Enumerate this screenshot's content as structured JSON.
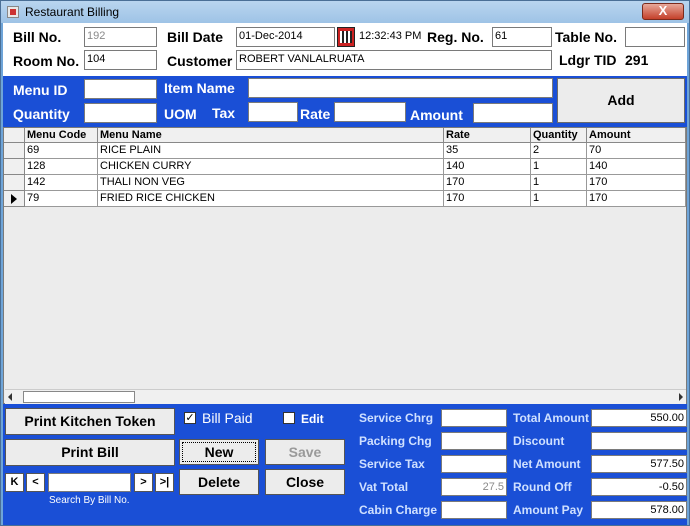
{
  "window": {
    "title": "Restaurant Billing",
    "close_label": "X"
  },
  "header": {
    "bill_no_label": "Bill No.",
    "bill_no": "192",
    "bill_date_label": "Bill Date",
    "bill_date": "01-Dec-2014",
    "time": "12:32:43 PM",
    "reg_no_label": "Reg. No.",
    "reg_no": "61",
    "table_no_label": "Table No.",
    "table_no": "",
    "room_no_label": "Room No.",
    "room_no": "104",
    "customer_label": "Customer",
    "customer": "ROBERT VANLALRUATA",
    "ledger_tid_label": "Ldgr TID",
    "ledger_tid": "291"
  },
  "entry": {
    "menu_id_label": "Menu ID",
    "menu_id": "",
    "item_name_label": "Item Name",
    "item_name": "",
    "quantity_label": "Quantity",
    "quantity": "",
    "uom_label": "UOM",
    "tax_label": "Tax",
    "tax": "",
    "rate_label": "Rate",
    "rate": "",
    "amount_label": "Amount",
    "amount": "",
    "add_label": "Add"
  },
  "grid": {
    "columns": [
      "Menu Code",
      "Menu Name",
      "Rate",
      "Quantity",
      "Amount"
    ],
    "rows": [
      {
        "code": "69",
        "name": "RICE PLAIN",
        "rate": "35",
        "qty": "2",
        "amount": "70"
      },
      {
        "code": "128",
        "name": "CHICKEN CURRY",
        "rate": "140",
        "qty": "1",
        "amount": "140"
      },
      {
        "code": "142",
        "name": "THALI NON VEG",
        "rate": "170",
        "qty": "1",
        "amount": "170"
      },
      {
        "code": "79",
        "name": "FRIED RICE CHICKEN",
        "rate": "170",
        "qty": "1",
        "amount": "170"
      }
    ]
  },
  "actions": {
    "print_kitchen_token": "Print Kitchen Token",
    "print_bill": "Print Bill",
    "bill_paid_label": "Bill Paid",
    "bill_paid_checked": true,
    "edit_label": "Edit",
    "edit_checked": false,
    "new_label": "New",
    "save_label": "Save",
    "delete_label": "Delete",
    "close_label": "Close",
    "nav_first": "K",
    "nav_prev": "<",
    "nav_next": ">",
    "nav_last": ">|",
    "search_value": "",
    "search_caption": "Search By Bill No."
  },
  "charges": {
    "service_chrg_label": "Service Chrg",
    "service_chrg": "",
    "packing_chg_label": "Packing Chg",
    "packing_chg": "",
    "service_tax_label": "Service Tax",
    "service_tax": "",
    "vat_total_label": "Vat Total",
    "vat_total": "27.5",
    "cabin_charge_label": "Cabin Charge",
    "cabin_charge": ""
  },
  "totals": {
    "total_amount_label": "Total Amount",
    "total_amount": "550.00",
    "discount_label": "Discount",
    "discount": "",
    "net_amount_label": "Net Amount",
    "net_amount": "577.50",
    "round_off_label": "Round Off",
    "round_off": "-0.50",
    "amount_pay_label": "Amount Pay",
    "amount_pay": "578.00"
  }
}
